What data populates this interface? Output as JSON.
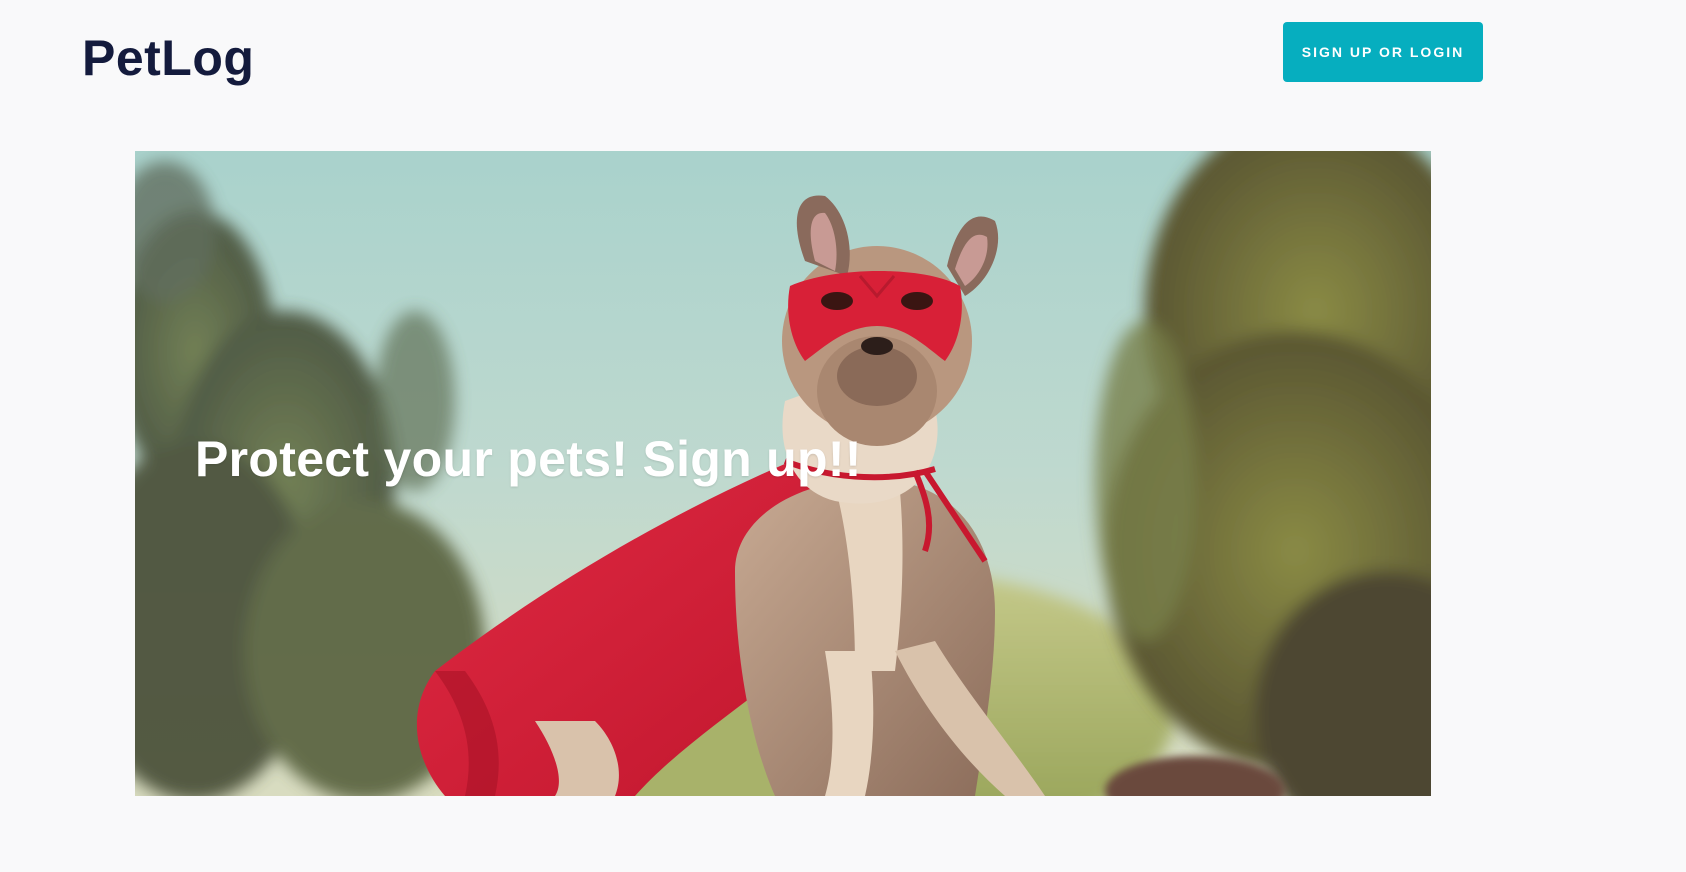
{
  "header": {
    "logo_text": "PetLog",
    "signup_button_label": "SIGN UP OR LOGIN"
  },
  "hero": {
    "headline": "Protect your pets! Sign up!!",
    "image_alt": "dog in red superhero mask and cape"
  },
  "colors": {
    "background": "#f9f9fa",
    "logo": "#141b3d",
    "button_accent": "#06aebf",
    "hero_text": "#ffffff",
    "cape_red": "#d4213a"
  }
}
